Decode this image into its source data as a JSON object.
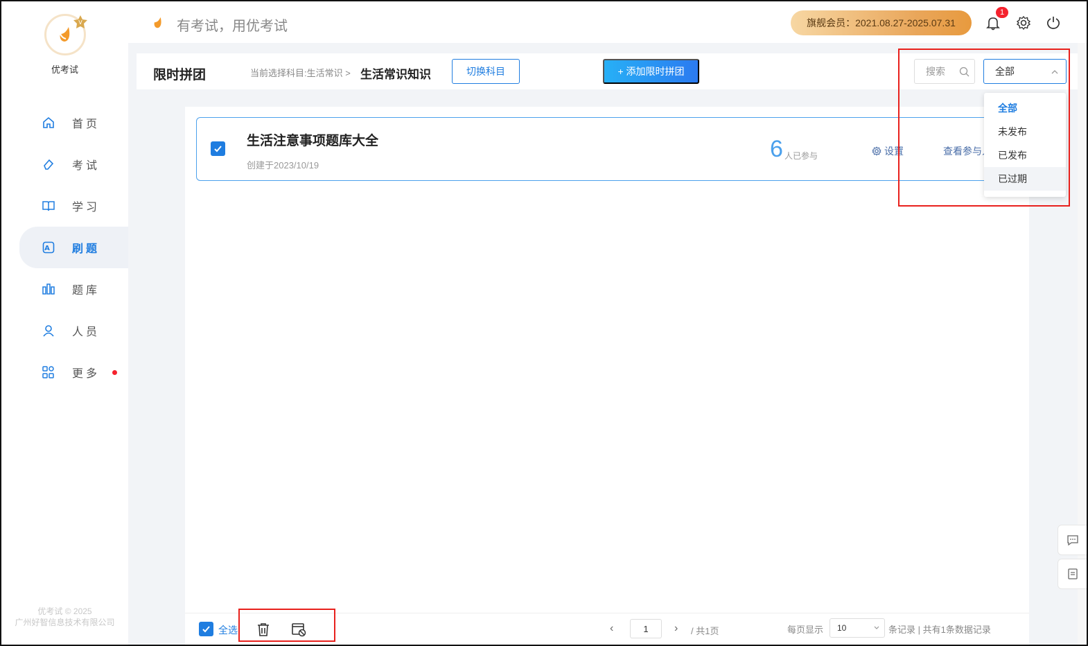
{
  "app": {
    "logo_text": "优考试",
    "slogan": "有考试，用优考试",
    "copyright_line1": "优考试 © 2025",
    "copyright_line2": "广州好智信息技术有限公司"
  },
  "header": {
    "member_text": "旗舰会员：2021.08.27-2025.07.31",
    "notification_count": "1"
  },
  "sidebar": {
    "items": [
      {
        "label": "首页",
        "icon": "home-icon"
      },
      {
        "label": "考试",
        "icon": "eraser-icon"
      },
      {
        "label": "学习",
        "icon": "book-icon"
      },
      {
        "label": "刷题",
        "icon": "quiz-a-icon",
        "active": true
      },
      {
        "label": "题库",
        "icon": "library-icon"
      },
      {
        "label": "人员",
        "icon": "user-icon"
      },
      {
        "label": "更多",
        "icon": "apps-icon",
        "dot": true
      }
    ]
  },
  "toolbar": {
    "title": "限时拼团",
    "crumb_prefix": "当前选择科目:生活常识 >",
    "crumb_current": "生活常识知识",
    "switch_label": "切换科目",
    "add_label": "+ 添加限时拼团",
    "search_placeholder": "搜索",
    "filter_value": "全部"
  },
  "dropdown": {
    "options": [
      "全部",
      "未发布",
      "已发布",
      "已过期"
    ],
    "selected": "全部",
    "hovered": "已过期"
  },
  "card": {
    "title": "生活注意事项题库大全",
    "date": "创建于2023/10/19",
    "count": "6",
    "count_label": "人已参与",
    "settings_label": "设置",
    "view_label": "查看参与人"
  },
  "footer": {
    "select_all": "全选",
    "page": "1",
    "page_total": "/ 共1页",
    "per_page_label": "每页显示",
    "per_page_value": "10",
    "records_label": "条记录 | 共有1条数据记录"
  },
  "colors": {
    "accent": "#1f7de0",
    "highlight": "#e8201c",
    "member_gold": "#e9a65a",
    "badge": "#f5222d"
  }
}
